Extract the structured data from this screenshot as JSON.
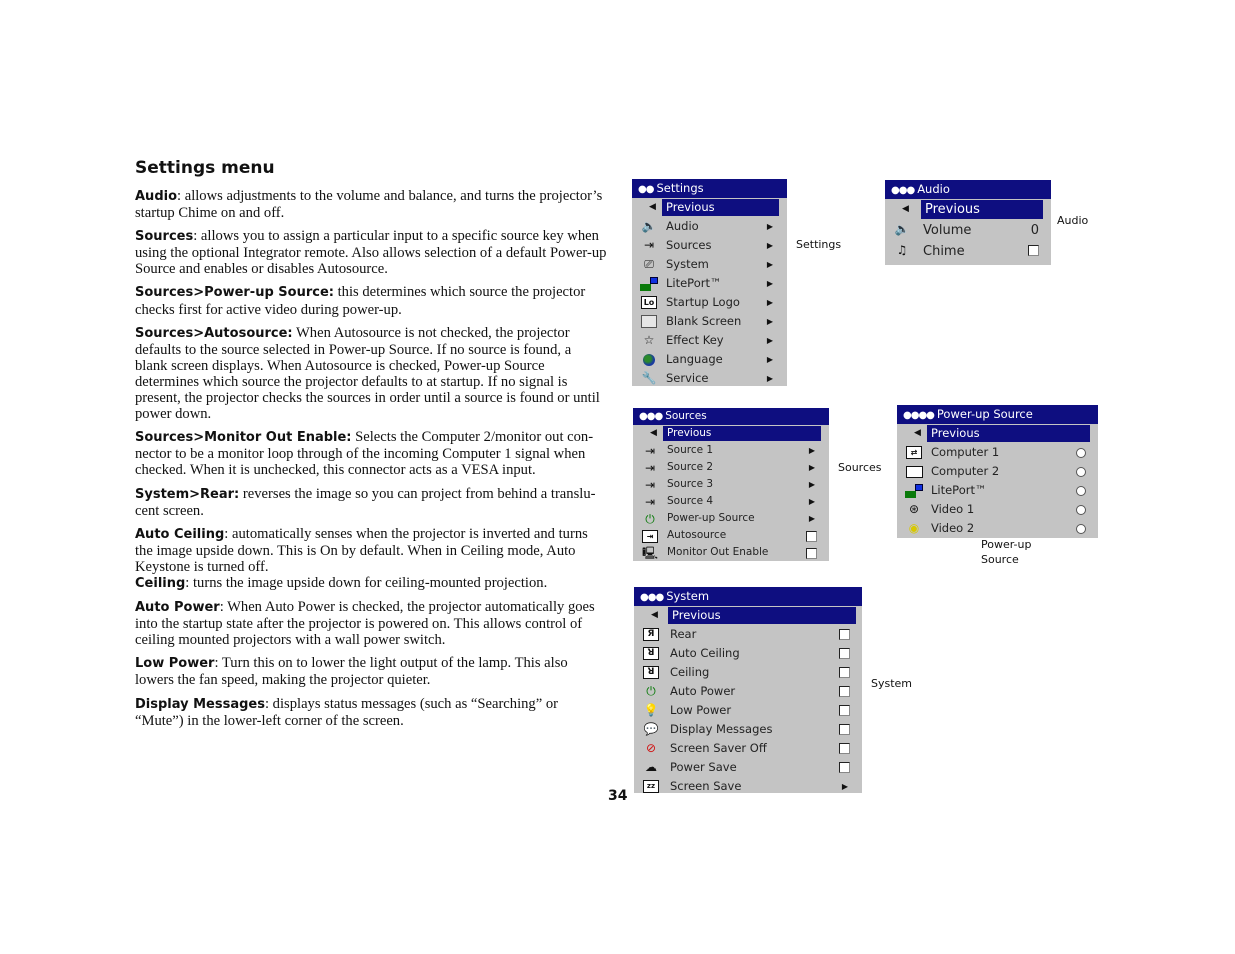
{
  "document": {
    "title": "Settings menu",
    "page_number": "34",
    "paragraphs": [
      {
        "term": "Audio",
        "text": ": allows adjustments to the volume and balance, and turns the projec­tor’s startup Chime on and off."
      },
      {
        "term": "Sources",
        "text": ": allows you to assign a particular input to a specific source key when using the optional Integrator remote. Also allows selection of a default Power-up Source and enables or disables Autosource."
      },
      {
        "term": "Sources>Power-up Source:",
        "text": " this determines which source the projector checks first for active video during power-up."
      },
      {
        "term": "Sources>Autosource:",
        "text": " When Autosource is not checked, the projector defaults to the source selected in Power-up Source. If no source is found, a blank screen displays. When Autosource is checked, Power-up Source determines which source the projector defaults to at startup. If no signal is present, the projector checks the sources in order until a source is found or until power down."
      },
      {
        "term": "Sources>Monitor Out Enable:",
        "text": " Selects the Computer 2/monitor out con­nector to be a monitor loop through of the incoming Computer 1 signal when checked. When it is unchecked, this connector acts as a VESA input."
      },
      {
        "term": "System>Rear:",
        "text": " reverses the image so you can project from behind a translu­cent screen."
      },
      {
        "term": "Auto Ceiling",
        "text": ": automatically senses when the projector is inverted and turns the image upside down. This is On by default. When in Ceiling mode, Auto Keystone is turned off."
      },
      {
        "term": "Ceiling",
        "text": ": turns the image upside down for ceiling-mounted projection."
      },
      {
        "term": "Auto Power",
        "text": ": When Auto Power is checked, the projector automatically goes into the startup state after the projector is powered on. This allows con­trol of ceiling mounted projectors with a wall power switch."
      },
      {
        "term": "Low Power",
        "text": ": Turn this on to lower the light output of the lamp. This also lowers the fan speed, making the projector quieter."
      },
      {
        "term": "Display Messages",
        "text": ": displays status messages (such as “Searching” or “Mute”) in the lower-left corner of the screen."
      }
    ]
  },
  "colors": {
    "menu_title_bg": "#0e0e80",
    "menu_bg": "#c4c4c4",
    "highlight_bg": "#0e0e80",
    "highlight_text": "#ffffff"
  },
  "captions": {
    "settings": "Settings",
    "audio": "Audio",
    "sources": "Sources",
    "powerup_line1": "Power-up",
    "powerup_line2": "Source",
    "system": "System"
  },
  "menus": {
    "settings": {
      "dots": "●●",
      "title": "Settings",
      "previous": "Previous",
      "items": [
        {
          "icon": "speaker-icon",
          "label": "Audio",
          "control": "submenu"
        },
        {
          "icon": "source-input-icon",
          "label": "Sources",
          "control": "submenu"
        },
        {
          "icon": "projector-icon",
          "label": "System",
          "control": "submenu"
        },
        {
          "icon": "liteport-icon",
          "label": "LitePort™",
          "control": "submenu"
        },
        {
          "icon": "logo-icon",
          "label": "Startup Logo",
          "control": "submenu"
        },
        {
          "icon": "blank-screen-icon",
          "label": "Blank Screen",
          "control": "submenu"
        },
        {
          "icon": "star-icon",
          "label": "Effect Key",
          "control": "submenu"
        },
        {
          "icon": "globe-icon",
          "label": "Language",
          "control": "submenu"
        },
        {
          "icon": "wrench-icon",
          "label": "Service",
          "control": "submenu"
        }
      ]
    },
    "audio": {
      "dots": "●●●",
      "title": "Audio",
      "previous": "Previous",
      "items": [
        {
          "icon": "volume-icon",
          "label": "Volume",
          "control": "value",
          "value": "0"
        },
        {
          "icon": "chime-icon",
          "label": "Chime",
          "control": "checkbox",
          "checked": false
        }
      ]
    },
    "sources": {
      "dots": "●●●",
      "title": "Sources",
      "previous": "Previous",
      "items": [
        {
          "icon": "source-1-icon",
          "label": "Source 1",
          "control": "submenu"
        },
        {
          "icon": "source-2-icon",
          "label": "Source 2",
          "control": "submenu"
        },
        {
          "icon": "source-3-icon",
          "label": "Source 3",
          "control": "submenu"
        },
        {
          "icon": "source-4-icon",
          "label": "Source 4",
          "control": "submenu"
        },
        {
          "icon": "powerup-source-icon",
          "label": "Power-up Source",
          "control": "submenu"
        },
        {
          "icon": "autosource-icon",
          "label": "Autosource",
          "control": "checkbox",
          "checked": false
        },
        {
          "icon": "monitor-out-icon",
          "label": "Monitor Out Enable",
          "control": "checkbox",
          "checked": false
        }
      ]
    },
    "powerup": {
      "dots": "●●●●",
      "title": "Power-up Source",
      "previous": "Previous",
      "items": [
        {
          "icon": "computer-1-icon",
          "label": "Computer 1",
          "control": "radio",
          "selected": false
        },
        {
          "icon": "computer-2-icon",
          "label": "Computer 2",
          "control": "radio",
          "selected": false
        },
        {
          "icon": "liteport-icon",
          "label": "LitePort™",
          "control": "radio",
          "selected": false
        },
        {
          "icon": "svideo-icon",
          "label": "Video 1",
          "control": "radio",
          "selected": false
        },
        {
          "icon": "composite-video-icon",
          "label": "Video 2",
          "control": "radio",
          "selected": false
        }
      ]
    },
    "system": {
      "dots": "●●●",
      "title": "System",
      "previous": "Previous",
      "items": [
        {
          "icon": "rear-icon",
          "label": "Rear",
          "control": "checkbox",
          "checked": false
        },
        {
          "icon": "auto-ceiling-icon",
          "label": "Auto Ceiling",
          "control": "checkbox",
          "checked": false
        },
        {
          "icon": "ceiling-icon",
          "label": "Ceiling",
          "control": "checkbox",
          "checked": false
        },
        {
          "icon": "auto-power-icon",
          "label": "Auto Power",
          "control": "checkbox",
          "checked": false
        },
        {
          "icon": "lightbulb-icon",
          "label": "Low Power",
          "control": "checkbox",
          "checked": false
        },
        {
          "icon": "speech-bubble-icon",
          "label": "Display Messages",
          "control": "checkbox",
          "checked": false
        },
        {
          "icon": "screen-saver-off-icon",
          "label": "Screen Saver Off",
          "control": "checkbox",
          "checked": false
        },
        {
          "icon": "power-save-icon",
          "label": "Power Save",
          "control": "checkbox",
          "checked": false
        },
        {
          "icon": "screen-save-icon",
          "label": "Screen Save",
          "control": "submenu"
        }
      ]
    }
  }
}
